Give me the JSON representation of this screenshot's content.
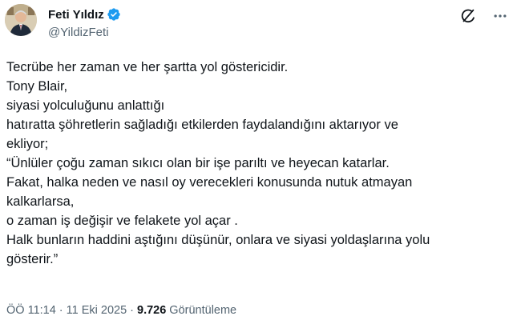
{
  "author": {
    "display_name": "Feti Yıldız",
    "handle": "@YildizFeti",
    "verified_color": "#1d9bf0"
  },
  "actions": {
    "grok_icon": "grok-icon",
    "more_icon": "more-horizontal-icon"
  },
  "tweet": {
    "lines": [
      "Tecrübe her zaman ve her şartta yol göstericidir.",
      "Tony Blair,",
      "siyasi yolculuğunu anlattığı",
      "hatıratta şöhretlerin sağladığı etkilerden faydalandığını aktarıyor ve",
      "ekliyor;",
      "“Ünlüler çoğu zaman sıkıcı olan bir işe parıltı ve heyecan katarlar.",
      "Fakat, halka neden ve nasıl oy verecekleri konusunda nutuk atmayan",
      "kalkarlarsa,",
      "o zaman iş değişir ve felakete yol açar .",
      "Halk bunların haddini aştığını düşünür, onlara ve siyasi yoldaşlarına yolu",
      "gösterir.”"
    ]
  },
  "meta": {
    "time": "ÖÖ 11:14",
    "separator": "·",
    "date": "11 Eki 2025",
    "views_count": "9.726",
    "views_label": "Görüntüleme"
  }
}
